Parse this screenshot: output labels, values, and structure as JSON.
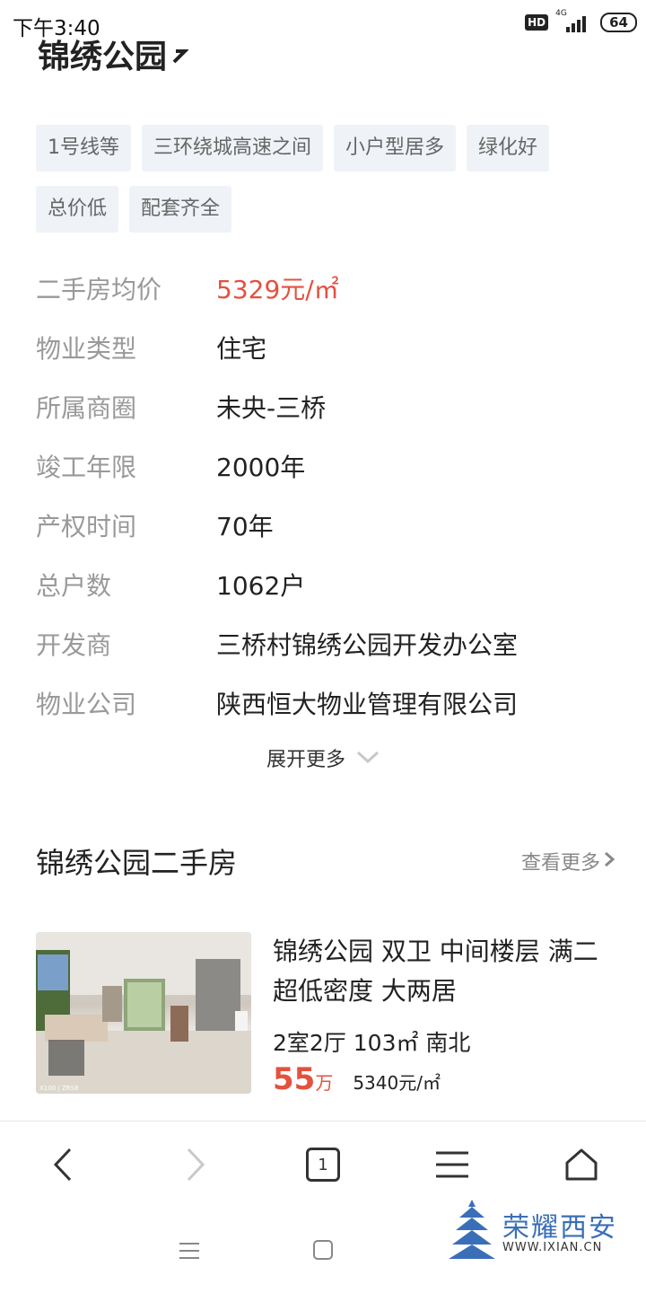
{
  "status_bar": {
    "time": "下午3:40",
    "hd": "HD",
    "network": "4G",
    "battery": "64"
  },
  "community": {
    "name": "锦绣公园",
    "tags": [
      "1号线等",
      "三环绕城高速之间",
      "小户型居多",
      "绿化好",
      "总价低",
      "配套齐全"
    ],
    "info": [
      {
        "label": "二手房均价",
        "value": "5329元/㎡",
        "highlight": true
      },
      {
        "label": "物业类型",
        "value": "住宅"
      },
      {
        "label": "所属商圈",
        "value": "未央-三桥"
      },
      {
        "label": "竣工年限",
        "value": "2000年"
      },
      {
        "label": "产权时间",
        "value": "70年"
      },
      {
        "label": "总户数",
        "value": "1062户"
      },
      {
        "label": "开发商",
        "value": "三桥村锦绣公园开发办公室"
      },
      {
        "label": "物业公司",
        "value": "陕西恒大物业管理有限公司"
      }
    ],
    "expand_label": "展开更多"
  },
  "second_hand": {
    "section_title": "锦绣公园二手房",
    "more_label": "查看更多",
    "listing": {
      "title": "锦绣公园 双卫 中间楼层 满二 超低密度 大两居",
      "specs": "2室2厅 103㎡ 南北",
      "total_price": "55",
      "total_unit": "万",
      "unit_price": "5340元/㎡",
      "photo_caption": "X100 | ZRS8"
    }
  },
  "browser": {
    "tab_count": "1"
  },
  "watermark": {
    "text": "荣耀西安",
    "url": "WWW.IXIAN.CN"
  },
  "colors": {
    "accent_red": "#e2523f",
    "tag_bg": "#eff2f7",
    "watermark_blue": "#3a6fb8"
  }
}
